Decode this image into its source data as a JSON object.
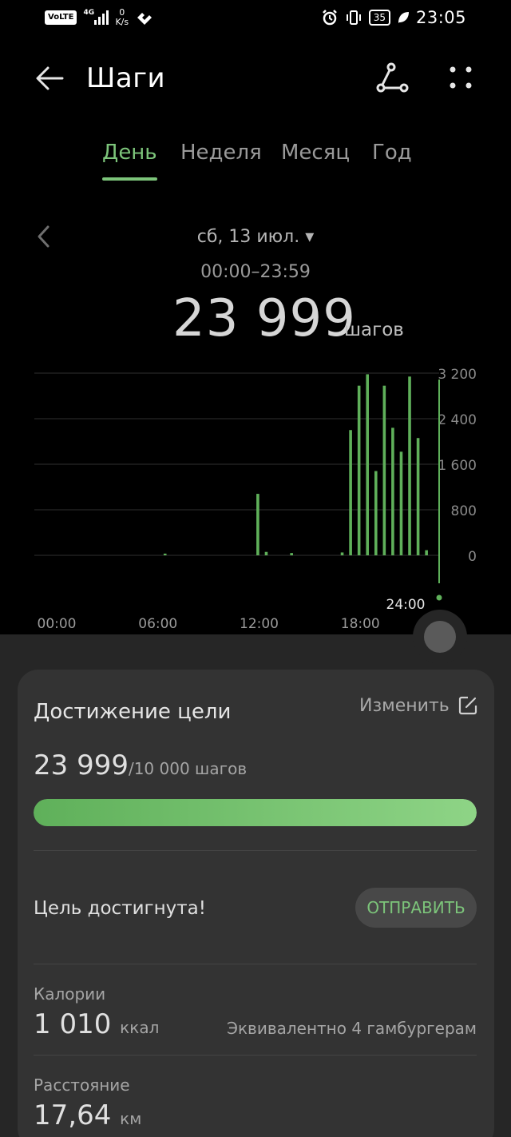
{
  "status_bar": {
    "volte": "VoLTE",
    "network": "4G",
    "speed_value": "0",
    "speed_unit": "K/s",
    "battery": "35",
    "time": "23:05"
  },
  "app_bar": {
    "title": "Шаги"
  },
  "tabs": [
    {
      "label": "День",
      "active": true
    },
    {
      "label": "Неделя",
      "active": false
    },
    {
      "label": "Месяц",
      "active": false
    },
    {
      "label": "Год",
      "active": false
    }
  ],
  "summary": {
    "date": "сб, 13 июл. ▾",
    "time_range": "00:00–23:59",
    "steps": "23 999",
    "unit": "шагов"
  },
  "chart_data": {
    "type": "bar",
    "x_ticks": [
      "00:00",
      "06:00",
      "12:00",
      "18:00"
    ],
    "cursor_label": "24:00",
    "y_ticks": [
      "3 200",
      "2 400",
      "1 600",
      "800",
      "0"
    ],
    "ylim": [
      0,
      3200
    ],
    "grid": true,
    "bar_color": "#5fb05a",
    "x": [
      7.75,
      13.25,
      13.75,
      15.25,
      18.25,
      18.75,
      19.25,
      19.75,
      20.25,
      20.75,
      21.25,
      21.75,
      22.25,
      22.75,
      23.25
    ],
    "values": [
      30,
      1080,
      60,
      40,
      50,
      2200,
      2980,
      3180,
      1480,
      2980,
      2240,
      1820,
      3140,
      2060,
      90
    ]
  },
  "goal": {
    "title": "Достижение цели",
    "edit_label": "Изменить",
    "value": "23 999",
    "target": "/10 000 шагов",
    "progress": 1.0,
    "reached_text": "Цель достигнута!",
    "send_label": "ОТПРАВИТЬ"
  },
  "calories": {
    "label": "Калории",
    "value": "1 010",
    "unit": "ккал",
    "equivalent": "Эквивалентно 4 гамбургерам"
  },
  "distance": {
    "label": "Расстояние",
    "value": "17,64",
    "unit": "км"
  },
  "colors": {
    "accent": "#7cc47a",
    "background": "#000000",
    "card": "#333333"
  }
}
